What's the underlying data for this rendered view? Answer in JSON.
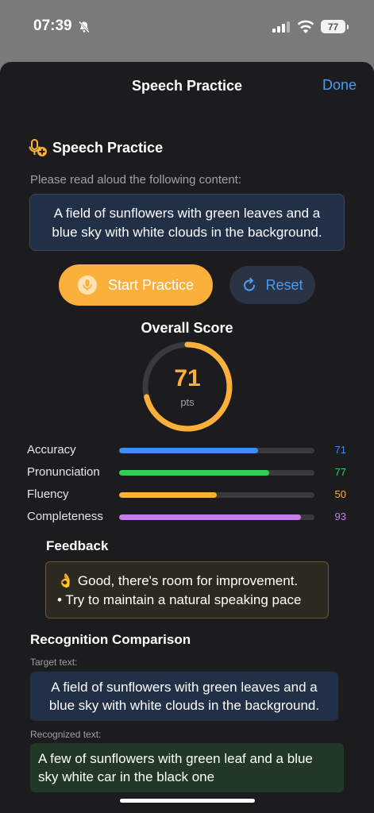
{
  "status": {
    "time": "07:39",
    "battery": "77"
  },
  "nav": {
    "title": "Speech Practice",
    "done_label": "Done"
  },
  "practice": {
    "section_title": "Speech Practice",
    "instruction": "Please read aloud the following content:",
    "prompt_text": "A field of sunflowers with green leaves and a blue sky with white clouds in the background.",
    "start_label": "Start Practice",
    "reset_label": "Reset"
  },
  "score": {
    "title": "Overall Score",
    "value": "71",
    "unit": "pts",
    "fraction": 0.71,
    "color": "#fbb03b"
  },
  "metrics": [
    {
      "label": "Accuracy",
      "value": "71",
      "fraction": 0.71,
      "color": "#3d8ff5"
    },
    {
      "label": "Pronunciation",
      "value": "77",
      "fraction": 0.77,
      "color": "#30d158"
    },
    {
      "label": "Fluency",
      "value": "50",
      "fraction": 0.5,
      "color": "#fbb03b"
    },
    {
      "label": "Completeness",
      "value": "93",
      "fraction": 0.93,
      "color": "#c77dee"
    }
  ],
  "feedback": {
    "title": "Feedback",
    "line1": "👌 Good, there's room for improvement.",
    "line2": "• Try to maintain a natural speaking pace"
  },
  "comparison": {
    "title": "Recognition Comparison",
    "target_label": "Target text:",
    "target_text": "A field of sunflowers with green leaves and a blue sky with white clouds in the background.",
    "recognized_label": "Recognized text:",
    "recognized_text": "A few of sunflowers with green leaf and a blue sky white car in the black one"
  }
}
